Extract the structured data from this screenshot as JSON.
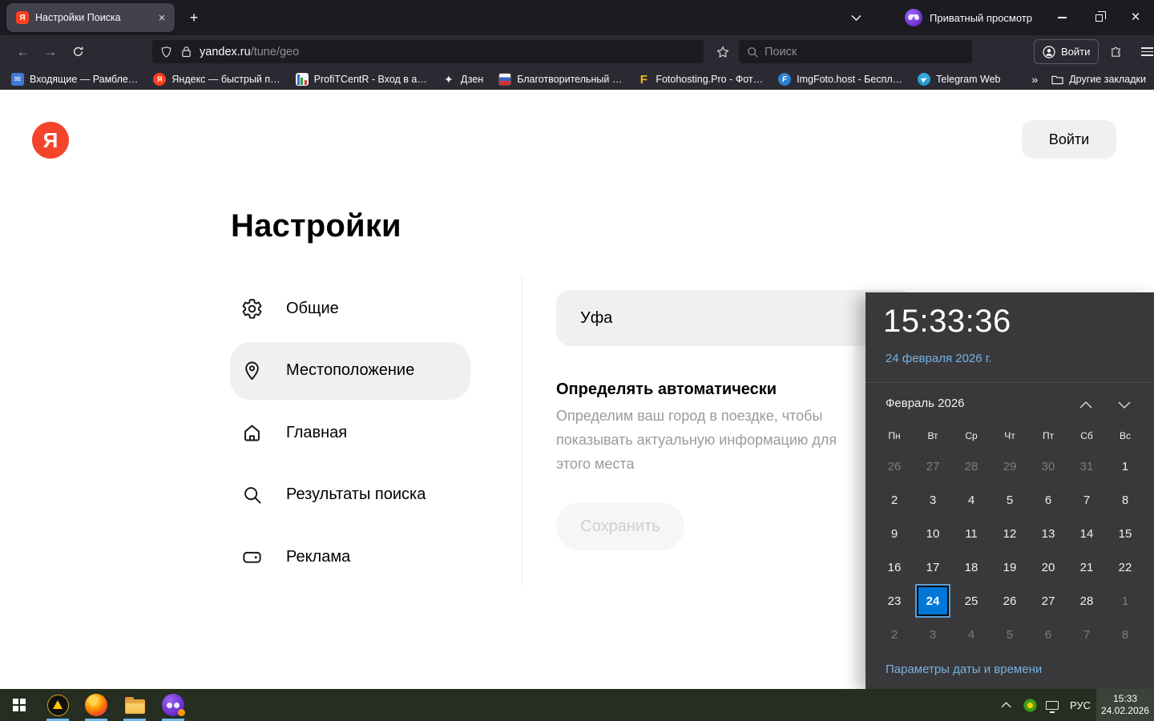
{
  "browser": {
    "tab_title": "Настройки Поиска",
    "private_label": "Приватный просмотр",
    "url_host": "yandex.ru",
    "url_path": "/tune/geo",
    "search_placeholder": "Поиск",
    "signin_label": "Войти",
    "bookmarks": [
      {
        "label": "Входящие — Рамбле…",
        "icon": "mail-icon"
      },
      {
        "label": "Яндекс — быстрый п…",
        "icon": "yandex-icon"
      },
      {
        "label": "ProfiTCentR - Вход в а…",
        "icon": "chart-icon"
      },
      {
        "label": "Дзен",
        "icon": "zen-icon"
      },
      {
        "label": "Благотворительный …",
        "icon": "flag-icon"
      },
      {
        "label": "Fotohosting.Pro - Фот…",
        "icon": "fotohosting-icon"
      },
      {
        "label": "ImgFoto.host - Беспл…",
        "icon": "imgfoto-icon"
      },
      {
        "label": "Telegram Web",
        "icon": "telegram-icon"
      }
    ],
    "other_bookmarks_label": "Другие закладки"
  },
  "page": {
    "signin_button": "Войти",
    "title": "Настройки",
    "menu": [
      {
        "label": "Общие",
        "icon": "gear",
        "selected": false
      },
      {
        "label": "Местоположение",
        "icon": "pin",
        "selected": true
      },
      {
        "label": "Главная",
        "icon": "home",
        "selected": false
      },
      {
        "label": "Результаты поиска",
        "icon": "search",
        "selected": false
      },
      {
        "label": "Реклама",
        "icon": "tag",
        "selected": false
      }
    ],
    "city_value": "Уфа",
    "auto_title": "Определять автоматически",
    "auto_description": "Определим ваш город в поездке, чтобы показывать актуальную информацию для этого места",
    "save_label": "Сохранить"
  },
  "clock": {
    "time": "15:33:36",
    "date_full": "24 февраля 2026 г.",
    "month_label": "Февраль 2026",
    "weekdays": [
      "Пн",
      "Вт",
      "Ср",
      "Чт",
      "Пт",
      "Сб",
      "Вс"
    ],
    "days": [
      {
        "n": "26",
        "m": true
      },
      {
        "n": "27",
        "m": true
      },
      {
        "n": "28",
        "m": true
      },
      {
        "n": "29",
        "m": true
      },
      {
        "n": "30",
        "m": true
      },
      {
        "n": "31",
        "m": true
      },
      {
        "n": "1"
      },
      {
        "n": "2"
      },
      {
        "n": "3"
      },
      {
        "n": "4"
      },
      {
        "n": "5"
      },
      {
        "n": "6"
      },
      {
        "n": "7"
      },
      {
        "n": "8"
      },
      {
        "n": "9"
      },
      {
        "n": "10"
      },
      {
        "n": "11"
      },
      {
        "n": "12"
      },
      {
        "n": "13"
      },
      {
        "n": "14"
      },
      {
        "n": "15"
      },
      {
        "n": "16"
      },
      {
        "n": "17"
      },
      {
        "n": "18"
      },
      {
        "n": "19"
      },
      {
        "n": "20"
      },
      {
        "n": "21"
      },
      {
        "n": "22"
      },
      {
        "n": "23"
      },
      {
        "n": "24",
        "s": true
      },
      {
        "n": "25"
      },
      {
        "n": "26"
      },
      {
        "n": "27"
      },
      {
        "n": "28"
      },
      {
        "n": "1",
        "m": true
      },
      {
        "n": "2",
        "m": true
      },
      {
        "n": "3",
        "m": true
      },
      {
        "n": "4",
        "m": true
      },
      {
        "n": "5",
        "m": true
      },
      {
        "n": "6",
        "m": true
      },
      {
        "n": "7",
        "m": true
      },
      {
        "n": "8",
        "m": true
      }
    ],
    "settings_link": "Параметры даты и времени"
  },
  "taskbar": {
    "language": "РУС",
    "tray_time": "15:33",
    "tray_date": "24.02.2026"
  }
}
